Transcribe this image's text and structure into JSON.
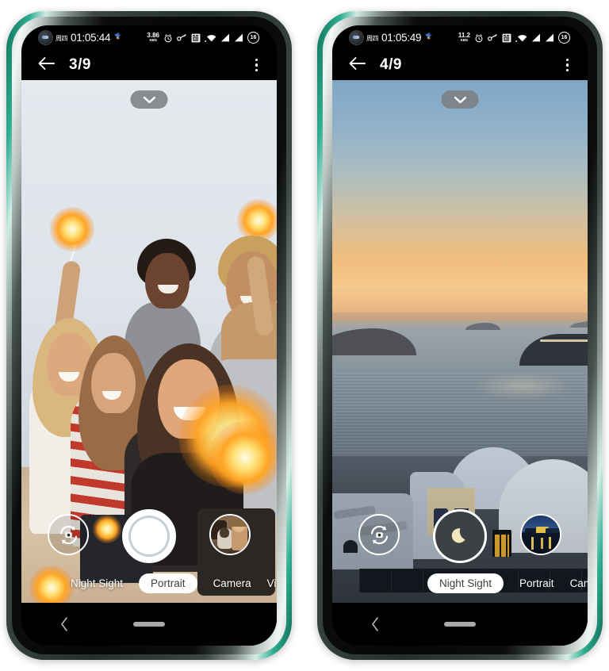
{
  "background_color": "#ffffff",
  "phones": [
    {
      "id": "phone-left",
      "frame_color": "#1f8f76",
      "status_bar": {
        "day_label": "周四",
        "time": "01:05:44",
        "bird_icon": "bird-icon",
        "net_speed_value": "3.86",
        "net_speed_unit": "KB/s",
        "icons": [
          "alarm-icon",
          "vpn-key-icon",
          "sim-card-icon",
          "wifi-icon",
          "signal-one-icon",
          "signal-two-icon"
        ],
        "battery_level": "16"
      },
      "app_bar": {
        "back_icon": "back-arrow-icon",
        "title": "3/9",
        "overflow_icon": "kebab-menu-icon"
      },
      "viewfinder": {
        "collapse_icon": "chevron-down-icon",
        "photo_description": "group-selfie-with-sparklers"
      },
      "controls": {
        "flip_camera_icon": "flip-camera-icon",
        "shutter_style": "portrait",
        "shutter_icon": "shutter-ring-icon",
        "thumbnail_icon": "gallery-thumbnail-woman-with-dog"
      },
      "modes": [
        {
          "label": "Night Sight",
          "active": false
        },
        {
          "label": "Portrait",
          "active": true
        },
        {
          "label": "Camera",
          "active": false
        },
        {
          "label": "Video",
          "active": false
        }
      ],
      "nav_bar": {
        "back_icon": "nav-back-icon",
        "home_icon": "home-handle-icon"
      }
    },
    {
      "id": "phone-right",
      "frame_color": "#1f8f76",
      "status_bar": {
        "day_label": "周四",
        "time": "01:05:49",
        "bird_icon": "bird-icon",
        "net_speed_value": "11.2",
        "net_speed_unit": "KB/s",
        "icons": [
          "alarm-icon",
          "vpn-key-icon",
          "sim-card-icon",
          "wifi-icon",
          "signal-one-icon",
          "signal-two-icon"
        ],
        "battery_level": "16"
      },
      "app_bar": {
        "back_icon": "back-arrow-icon",
        "title": "4/9",
        "overflow_icon": "kebab-menu-icon"
      },
      "viewfinder": {
        "collapse_icon": "chevron-down-icon",
        "photo_description": "santorini-sunset-over-sea"
      },
      "controls": {
        "flip_camera_icon": "flip-camera-icon",
        "shutter_style": "night",
        "shutter_icon": "crescent-moon-icon",
        "thumbnail_icon": "gallery-thumbnail-night-harbor"
      },
      "modes": [
        {
          "label": "Night Sight",
          "active": true
        },
        {
          "label": "Portrait",
          "active": false
        },
        {
          "label": "Camera",
          "active": false
        }
      ],
      "nav_bar": {
        "back_icon": "nav-back-icon",
        "home_icon": "home-handle-icon"
      }
    }
  ]
}
